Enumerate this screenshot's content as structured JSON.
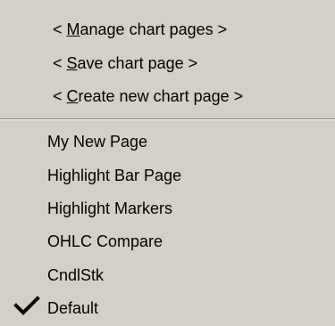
{
  "actions": [
    {
      "prefix": "< ",
      "mnemonic": "M",
      "rest": "anage chart pages >"
    },
    {
      "prefix": "< ",
      "mnemonic": "S",
      "rest": "ave chart page >"
    },
    {
      "prefix": "< ",
      "mnemonic": "C",
      "rest": "reate new chart page >"
    }
  ],
  "pages": [
    {
      "label": "My New Page",
      "checked": false
    },
    {
      "label": "Highlight Bar Page",
      "checked": false
    },
    {
      "label": "Highlight Markers",
      "checked": false
    },
    {
      "label": "OHLC Compare",
      "checked": false
    },
    {
      "label": "CndlStk",
      "checked": false
    },
    {
      "label": "Default",
      "checked": true
    }
  ],
  "icons": {
    "checkmark": "checkmark-icon"
  },
  "colors": {
    "menu_bg": "#d4d0c8",
    "text": "#000000",
    "separator_dark": "#808080",
    "separator_light": "#ffffff"
  }
}
